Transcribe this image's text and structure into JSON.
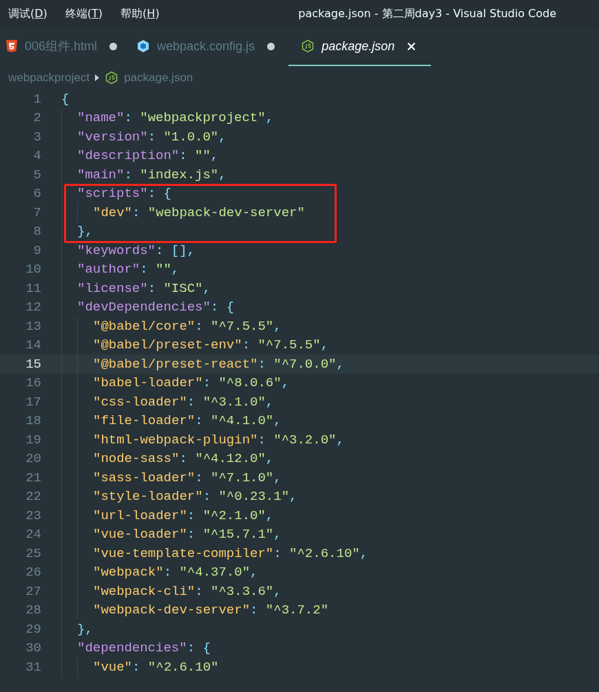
{
  "menu": [
    {
      "text": "调试(",
      "key": "D",
      "end": ")"
    },
    {
      "text": "终端(",
      "key": "T",
      "end": ")"
    },
    {
      "text": "帮助(",
      "key": "H",
      "end": ")"
    }
  ],
  "window": {
    "title": "package.json - 第二周day3 - Visual Studio Code"
  },
  "tabs": [
    {
      "label": "006组件.html",
      "kind": "html",
      "selected": false,
      "modified": true
    },
    {
      "label": "webpack.config.js",
      "kind": "webpack",
      "selected": false,
      "modified": true
    },
    {
      "label": "package.json",
      "kind": "node",
      "selected": true,
      "modified": false
    }
  ],
  "breadcrumb": [
    {
      "label": "webpackproject"
    },
    {
      "label": "package.json",
      "kind": "node"
    }
  ],
  "editor": {
    "lines": [
      {
        "number": "1",
        "current": false,
        "boxed": false,
        "tokens": [
          {
            "kind": "punct",
            "text": "{"
          }
        ],
        "children": [
          {
            "number": "2",
            "current": false,
            "boxed": false,
            "tokens": [
              {
                "kind": "key",
                "text": "\"name\""
              },
              {
                "kind": "punct",
                "text": ": "
              },
              {
                "kind": "string",
                "text": "\"webpackproject\""
              },
              {
                "kind": "punct",
                "text": ","
              }
            ]
          },
          {
            "number": "3",
            "current": false,
            "boxed": false,
            "tokens": [
              {
                "kind": "key",
                "text": "\"version\""
              },
              {
                "kind": "punct",
                "text": ": "
              },
              {
                "kind": "string",
                "text": "\"1.0.0\""
              },
              {
                "kind": "punct",
                "text": ","
              }
            ]
          },
          {
            "number": "4",
            "current": false,
            "boxed": false,
            "tokens": [
              {
                "kind": "key",
                "text": "\"description\""
              },
              {
                "kind": "punct",
                "text": ": "
              },
              {
                "kind": "string",
                "text": "\"\""
              },
              {
                "kind": "punct",
                "text": ","
              }
            ]
          },
          {
            "number": "5",
            "current": false,
            "boxed": false,
            "tokens": [
              {
                "kind": "key",
                "text": "\"main\""
              },
              {
                "kind": "punct",
                "text": ": "
              },
              {
                "kind": "string",
                "text": "\"index.js\""
              },
              {
                "kind": "punct",
                "text": ","
              }
            ]
          },
          {
            "number": "6",
            "current": false,
            "boxed": true,
            "tokens": [
              {
                "kind": "key",
                "text": "\"scripts\""
              },
              {
                "kind": "punct",
                "text": ": {"
              }
            ],
            "children": [
              {
                "number": "7",
                "current": false,
                "boxed": true,
                "tokens": [
                  {
                    "kind": "subkey",
                    "text": "\"dev\""
                  },
                  {
                    "kind": "punct",
                    "text": ": "
                  },
                  {
                    "kind": "string",
                    "text": "\"webpack-dev-server\""
                  }
                ]
              }
            ]
          },
          {
            "number": "8",
            "current": false,
            "boxed": true,
            "tokens": [
              {
                "kind": "punct",
                "text": "},"
              }
            ]
          },
          {
            "number": "9",
            "current": false,
            "boxed": false,
            "tokens": [
              {
                "kind": "key",
                "text": "\"keywords\""
              },
              {
                "kind": "punct",
                "text": ": [],"
              }
            ]
          },
          {
            "number": "10",
            "current": false,
            "boxed": false,
            "tokens": [
              {
                "kind": "key",
                "text": "\"author\""
              },
              {
                "kind": "punct",
                "text": ": "
              },
              {
                "kind": "string",
                "text": "\"\""
              },
              {
                "kind": "punct",
                "text": ","
              }
            ]
          },
          {
            "number": "11",
            "current": false,
            "boxed": false,
            "tokens": [
              {
                "kind": "key",
                "text": "\"license\""
              },
              {
                "kind": "punct",
                "text": ": "
              },
              {
                "kind": "string",
                "text": "\"ISC\""
              },
              {
                "kind": "punct",
                "text": ","
              }
            ]
          },
          {
            "number": "12",
            "current": false,
            "boxed": false,
            "tokens": [
              {
                "kind": "key",
                "text": "\"devDependencies\""
              },
              {
                "kind": "punct",
                "text": ": {"
              }
            ],
            "children": [
              {
                "number": "13",
                "current": false,
                "boxed": false,
                "tokens": [
                  {
                    "kind": "subkey",
                    "text": "\"@babel/core\""
                  },
                  {
                    "kind": "punct",
                    "text": ": "
                  },
                  {
                    "kind": "string",
                    "text": "\"^7.5.5\""
                  },
                  {
                    "kind": "punct",
                    "text": ","
                  }
                ]
              },
              {
                "number": "14",
                "current": false,
                "boxed": false,
                "tokens": [
                  {
                    "kind": "subkey",
                    "text": "\"@babel/preset-env\""
                  },
                  {
                    "kind": "punct",
                    "text": ": "
                  },
                  {
                    "kind": "string",
                    "text": "\"^7.5.5\""
                  },
                  {
                    "kind": "punct",
                    "text": ","
                  }
                ]
              },
              {
                "number": "15",
                "current": true,
                "boxed": false,
                "tokens": [
                  {
                    "kind": "subkey",
                    "text": "\"@babel/preset-react\""
                  },
                  {
                    "kind": "punct",
                    "text": ": "
                  },
                  {
                    "kind": "string",
                    "text": "\"^7.0.0\""
                  },
                  {
                    "kind": "punct",
                    "text": ","
                  }
                ]
              },
              {
                "number": "16",
                "current": false,
                "boxed": false,
                "tokens": [
                  {
                    "kind": "subkey",
                    "text": "\"babel-loader\""
                  },
                  {
                    "kind": "punct",
                    "text": ": "
                  },
                  {
                    "kind": "string",
                    "text": "\"^8.0.6\""
                  },
                  {
                    "kind": "punct",
                    "text": ","
                  }
                ]
              },
              {
                "number": "17",
                "current": false,
                "boxed": false,
                "tokens": [
                  {
                    "kind": "subkey",
                    "text": "\"css-loader\""
                  },
                  {
                    "kind": "punct",
                    "text": ": "
                  },
                  {
                    "kind": "string",
                    "text": "\"^3.1.0\""
                  },
                  {
                    "kind": "punct",
                    "text": ","
                  }
                ]
              },
              {
                "number": "18",
                "current": false,
                "boxed": false,
                "tokens": [
                  {
                    "kind": "subkey",
                    "text": "\"file-loader\""
                  },
                  {
                    "kind": "punct",
                    "text": ": "
                  },
                  {
                    "kind": "string",
                    "text": "\"^4.1.0\""
                  },
                  {
                    "kind": "punct",
                    "text": ","
                  }
                ]
              },
              {
                "number": "19",
                "current": false,
                "boxed": false,
                "tokens": [
                  {
                    "kind": "subkey",
                    "text": "\"html-webpack-plugin\""
                  },
                  {
                    "kind": "punct",
                    "text": ": "
                  },
                  {
                    "kind": "string",
                    "text": "\"^3.2.0\""
                  },
                  {
                    "kind": "punct",
                    "text": ","
                  }
                ]
              },
              {
                "number": "20",
                "current": false,
                "boxed": false,
                "tokens": [
                  {
                    "kind": "subkey",
                    "text": "\"node-sass\""
                  },
                  {
                    "kind": "punct",
                    "text": ": "
                  },
                  {
                    "kind": "string",
                    "text": "\"^4.12.0\""
                  },
                  {
                    "kind": "punct",
                    "text": ","
                  }
                ]
              },
              {
                "number": "21",
                "current": false,
                "boxed": false,
                "tokens": [
                  {
                    "kind": "subkey",
                    "text": "\"sass-loader\""
                  },
                  {
                    "kind": "punct",
                    "text": ": "
                  },
                  {
                    "kind": "string",
                    "text": "\"^7.1.0\""
                  },
                  {
                    "kind": "punct",
                    "text": ","
                  }
                ]
              },
              {
                "number": "22",
                "current": false,
                "boxed": false,
                "tokens": [
                  {
                    "kind": "subkey",
                    "text": "\"style-loader\""
                  },
                  {
                    "kind": "punct",
                    "text": ": "
                  },
                  {
                    "kind": "string",
                    "text": "\"^0.23.1\""
                  },
                  {
                    "kind": "punct",
                    "text": ","
                  }
                ]
              },
              {
                "number": "23",
                "current": false,
                "boxed": false,
                "tokens": [
                  {
                    "kind": "subkey",
                    "text": "\"url-loader\""
                  },
                  {
                    "kind": "punct",
                    "text": ": "
                  },
                  {
                    "kind": "string",
                    "text": "\"^2.1.0\""
                  },
                  {
                    "kind": "punct",
                    "text": ","
                  }
                ]
              },
              {
                "number": "24",
                "current": false,
                "boxed": false,
                "tokens": [
                  {
                    "kind": "subkey",
                    "text": "\"vue-loader\""
                  },
                  {
                    "kind": "punct",
                    "text": ": "
                  },
                  {
                    "kind": "string",
                    "text": "\"^15.7.1\""
                  },
                  {
                    "kind": "punct",
                    "text": ","
                  }
                ]
              },
              {
                "number": "25",
                "current": false,
                "boxed": false,
                "tokens": [
                  {
                    "kind": "subkey",
                    "text": "\"vue-template-compiler\""
                  },
                  {
                    "kind": "punct",
                    "text": ": "
                  },
                  {
                    "kind": "string",
                    "text": "\"^2.6.10\""
                  },
                  {
                    "kind": "punct",
                    "text": ","
                  }
                ]
              },
              {
                "number": "26",
                "current": false,
                "boxed": false,
                "tokens": [
                  {
                    "kind": "subkey",
                    "text": "\"webpack\""
                  },
                  {
                    "kind": "punct",
                    "text": ": "
                  },
                  {
                    "kind": "string",
                    "text": "\"^4.37.0\""
                  },
                  {
                    "kind": "punct",
                    "text": ","
                  }
                ]
              },
              {
                "number": "27",
                "current": false,
                "boxed": false,
                "tokens": [
                  {
                    "kind": "subkey",
                    "text": "\"webpack-cli\""
                  },
                  {
                    "kind": "punct",
                    "text": ": "
                  },
                  {
                    "kind": "string",
                    "text": "\"^3.3.6\""
                  },
                  {
                    "kind": "punct",
                    "text": ","
                  }
                ]
              },
              {
                "number": "28",
                "current": false,
                "boxed": false,
                "tokens": [
                  {
                    "kind": "subkey",
                    "text": "\"webpack-dev-server\""
                  },
                  {
                    "kind": "punct",
                    "text": ": "
                  },
                  {
                    "kind": "string",
                    "text": "\"^3.7.2\""
                  }
                ]
              }
            ]
          },
          {
            "number": "29",
            "current": false,
            "boxed": false,
            "tokens": [
              {
                "kind": "punct",
                "text": "},"
              }
            ]
          },
          {
            "number": "30",
            "current": false,
            "boxed": false,
            "tokens": [
              {
                "kind": "key",
                "text": "\"dependencies\""
              },
              {
                "kind": "punct",
                "text": ": {"
              }
            ],
            "children": [
              {
                "number": "31",
                "current": false,
                "boxed": false,
                "tokens": [
                  {
                    "kind": "subkey",
                    "text": "\"vue\""
                  },
                  {
                    "kind": "punct",
                    "text": ": "
                  },
                  {
                    "kind": "string",
                    "text": "\"^2.6.10\""
                  }
                ]
              }
            ]
          }
        ]
      }
    ]
  }
}
